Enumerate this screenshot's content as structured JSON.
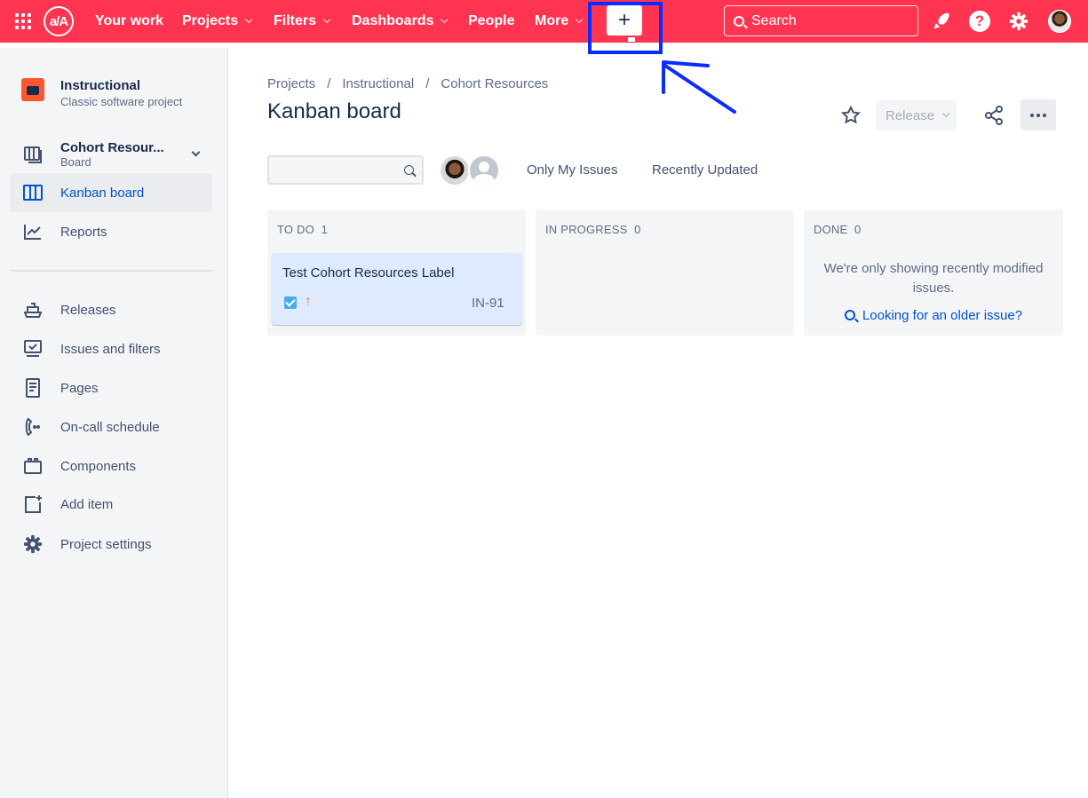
{
  "topnav": {
    "logo_text": "a/A",
    "items": [
      {
        "label": "Your work",
        "has_dropdown": false
      },
      {
        "label": "Projects",
        "has_dropdown": true
      },
      {
        "label": "Filters",
        "has_dropdown": true
      },
      {
        "label": "Dashboards",
        "has_dropdown": true
      },
      {
        "label": "People",
        "has_dropdown": false
      },
      {
        "label": "More",
        "has_dropdown": true
      }
    ],
    "create_label": "+",
    "search_placeholder": "Search",
    "help_label": "?",
    "accent_color": "#ff3451"
  },
  "sidebar": {
    "project_name": "Instructional",
    "project_type": "Classic software project",
    "board_name": "Cohort Resour...",
    "board_sub": "Board",
    "items": [
      {
        "label": "Kanban board",
        "icon": "board-icon",
        "active": true
      },
      {
        "label": "Reports",
        "icon": "chart-icon",
        "active": false
      },
      {
        "label": "Releases",
        "icon": "ship-icon",
        "active": false
      },
      {
        "label": "Issues and filters",
        "icon": "issues-icon",
        "active": false
      },
      {
        "label": "Pages",
        "icon": "page-icon",
        "active": false
      },
      {
        "label": "On-call schedule",
        "icon": "phone-icon",
        "active": false
      },
      {
        "label": "Components",
        "icon": "component-icon",
        "active": false
      },
      {
        "label": "Add item",
        "icon": "add-item-icon",
        "active": false
      },
      {
        "label": "Project settings",
        "icon": "gear-icon",
        "active": false
      }
    ]
  },
  "main": {
    "breadcrumb": [
      "Projects",
      "Instructional",
      "Cohort Resources"
    ],
    "breadcrumb_sep": "/",
    "title": "Kanban board",
    "release_label": "Release",
    "filters": [
      "Only My Issues",
      "Recently Updated"
    ],
    "columns": [
      {
        "name": "TO DO",
        "count": "1"
      },
      {
        "name": "IN PROGRESS",
        "count": "0"
      },
      {
        "name": "DONE",
        "count": "0"
      }
    ],
    "card": {
      "title": "Test Cohort Resources Label",
      "key": "IN-91",
      "priority_glyph": "↑"
    },
    "done_message": "We're only showing recently modified issues.",
    "older_issue_link": "Looking for an older issue?"
  }
}
